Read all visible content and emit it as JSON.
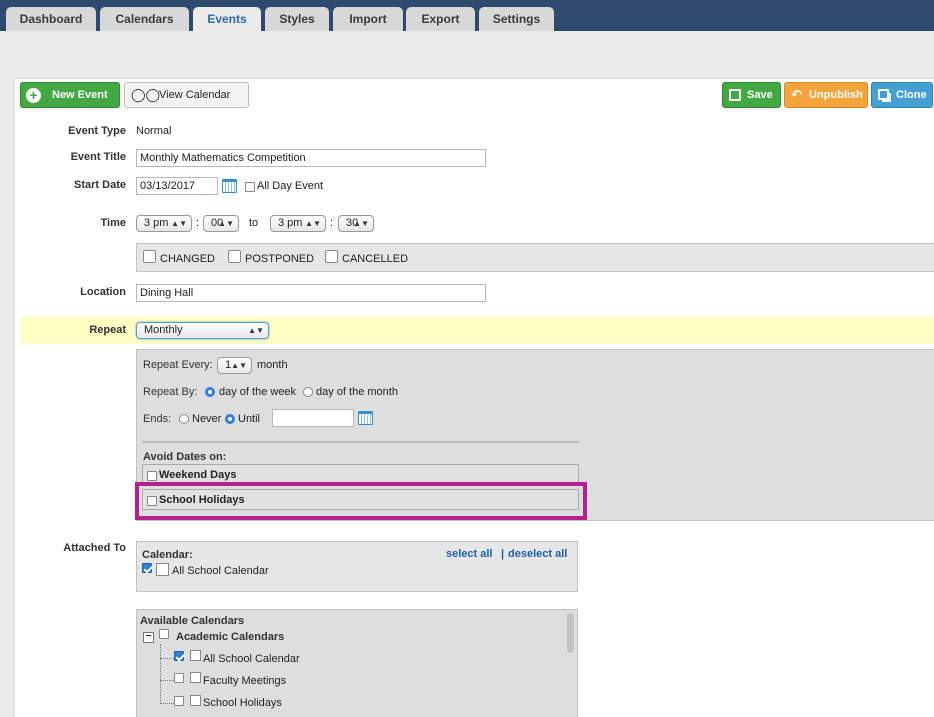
{
  "tabs": [
    "Dashboard",
    "Calendars",
    "Events",
    "Styles",
    "Import",
    "Export",
    "Settings"
  ],
  "active_tab": "Events",
  "toolbar": {
    "new_event": "New Event",
    "view_calendar": "View Calendar",
    "save": "Save",
    "unpublish": "Unpublish",
    "clone": "Clone"
  },
  "form": {
    "event_type_label": "Event Type",
    "event_type_value": "Normal",
    "event_title_label": "Event Title",
    "event_title_value": "Monthly Mathematics Competition",
    "start_date_label": "Start Date",
    "start_date_value": "03/13/2017",
    "all_day_label": "All Day Event",
    "time_label": "Time",
    "start_hour": "3 pm",
    "start_minute": "00",
    "to_label": "to",
    "end_hour": "3 pm",
    "end_minute": "30",
    "colon": ":",
    "status_changed": "CHANGED",
    "status_postponed": "POSTPONED",
    "status_cancelled": "CANCELLED",
    "location_label": "Location",
    "location_value": "Dining Hall",
    "repeat_label": "Repeat",
    "repeat_value": "Monthly"
  },
  "repeat": {
    "every_label": "Repeat Every:",
    "every_value": "1",
    "every_unit": "month",
    "by_label": "Repeat By:",
    "by_week": "day of the week",
    "by_month": "day of the month",
    "ends_label": "Ends:",
    "never": "Never",
    "until": "Until",
    "until_value": "",
    "avoid_label": "Avoid Dates on:",
    "avoid_weekend": "Weekend Days",
    "avoid_holidays": "School Holidays"
  },
  "attached": {
    "label": "Attached To",
    "calendar_label": "Calendar:",
    "select_all": "select all",
    "separator": "|",
    "deselect_all": "deselect all",
    "selected_calendar": "All School Calendar",
    "available_label": "Available Calendars",
    "group_name": "Academic Calendars",
    "items": [
      "All School Calendar",
      "Faculty Meetings",
      "School Holidays"
    ]
  },
  "colors": {
    "topbar": "#2f4a6f",
    "highlight_row": "#ffffc4",
    "annotation": "#b3218e"
  }
}
